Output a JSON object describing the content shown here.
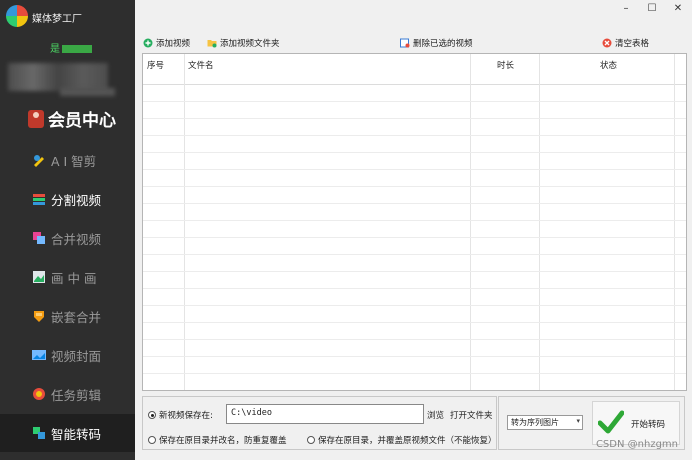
{
  "app": {
    "title": "媒体梦工厂",
    "vip_status": "是",
    "member_center_label": "会员中心"
  },
  "sidebar": {
    "items": [
      {
        "label": "A I 智剪",
        "icon": "ai-edit-icon"
      },
      {
        "label": "分割视频",
        "icon": "split-video-icon"
      },
      {
        "label": "合并视频",
        "icon": "merge-video-icon"
      },
      {
        "label": "画 中 画",
        "icon": "picture-in-picture-icon"
      },
      {
        "label": "嵌套合并",
        "icon": "nested-merge-icon"
      },
      {
        "label": "视频封面",
        "icon": "video-cover-icon"
      },
      {
        "label": "任务剪辑",
        "icon": "task-edit-icon"
      },
      {
        "label": "智能转码",
        "icon": "smart-transcode-icon"
      }
    ]
  },
  "window": {
    "minimize": "–",
    "maximize": "☐",
    "close": "✕"
  },
  "toolbar": {
    "add_video": "添加视频",
    "add_folder": "添加视频文件夹",
    "delete_selected": "删除已选的视频",
    "clear_table": "清空表格"
  },
  "table": {
    "columns": [
      "序号",
      "文件名",
      "时长",
      "状态"
    ],
    "rows": []
  },
  "save_options": {
    "new_path_label": "新视频保存在:",
    "path_value": "C:\\video",
    "browse": "浏览",
    "open_folder": "打开文件夹",
    "option_rename": "保存在原目录并改名，防重复覆盖",
    "option_overwrite": "保存在原目录，并覆盖原视频文件（不能恢复）"
  },
  "convert": {
    "format_selected": "转为序列图片",
    "start_button": "开始转码"
  },
  "watermark": "CSDN @nhzgmn",
  "colors": {
    "sidebar_bg": "#2e2e2e",
    "sidebar_active_bg": "#1f1f1f",
    "vip_green": "#4cd964",
    "check_green": "#2ea836"
  }
}
